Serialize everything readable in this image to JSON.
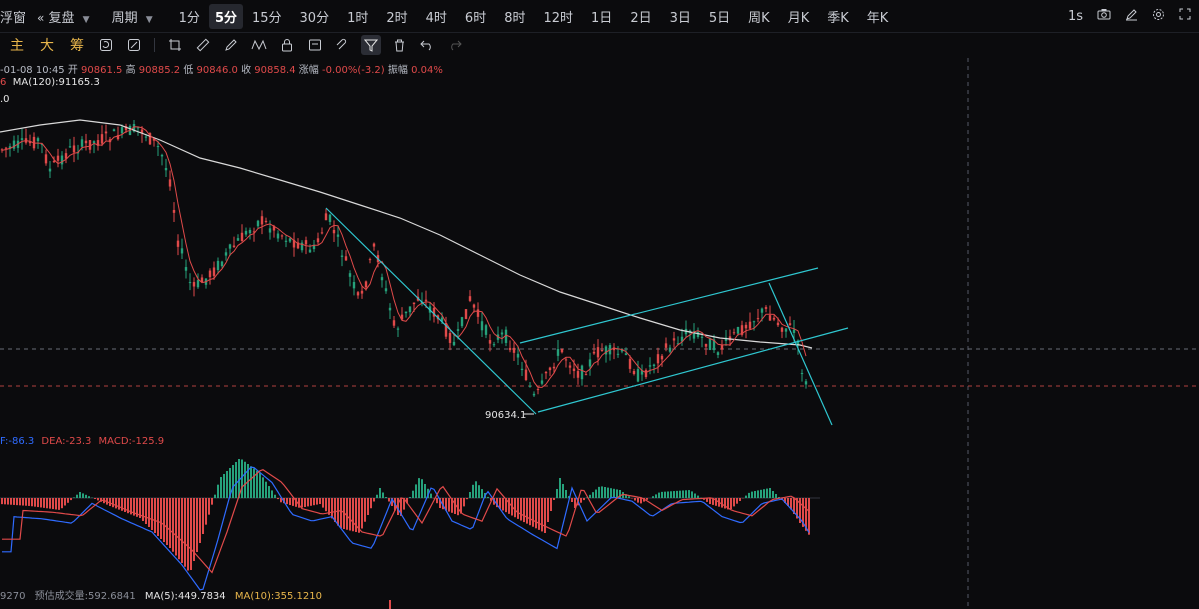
{
  "toolbar": {
    "left_partial": "浮窗",
    "restore": "复盘",
    "period": "周期",
    "intervals": [
      "1分",
      "5分",
      "15分",
      "30分",
      "1时",
      "2时",
      "4时",
      "6时",
      "8时",
      "12时",
      "1日",
      "2日",
      "3日",
      "5日",
      "周K",
      "月K",
      "季K",
      "年K"
    ],
    "active_interval": "5分",
    "speed": "1s"
  },
  "drawbar": {
    "labels": [
      "主",
      "大",
      "筹"
    ]
  },
  "info": {
    "date": "-01-08 10:45",
    "open_label": "开",
    "open": "90861.5",
    "high_label": "高",
    "high": "90885.2",
    "low_label": "低",
    "low": "90846.0",
    "close_label": "收",
    "close": "90858.4",
    "change_label": "涨幅",
    "change": "-0.00%(-3.2)",
    "amp_label": "振幅",
    "amp": "0.04%",
    "ma_prefix": "6",
    "ma120_label": "MA(120):",
    "ma120": "91165.3",
    "row3": ".0"
  },
  "macd": {
    "dif_label": "F:",
    "dif": "-86.3",
    "dea_label": "DEA:",
    "dea": "-23.3",
    "macd_label": "MACD:",
    "macd": "-125.9"
  },
  "volume": {
    "partial": "9270",
    "forecast_label": "预估成交量:",
    "forecast": "592.6841",
    "ma5_label": "MA(5):",
    "ma5": "449.7834",
    "ma10_label": "MA(10):",
    "ma10": "355.1210"
  },
  "annotation": {
    "low_price": "90634.1"
  },
  "colors": {
    "up": "#26a17b",
    "down": "#e04a4a",
    "ma": "#d9d9d9",
    "trendline": "#2fc7d0",
    "dif": "#2f6bff",
    "dea": "#e04a4a"
  },
  "chart_data": {
    "type": "candlestick",
    "series": [
      {
        "name": "MA(120)",
        "values": [
          91165.3
        ]
      }
    ],
    "annotations": [
      "90634.1"
    ]
  }
}
